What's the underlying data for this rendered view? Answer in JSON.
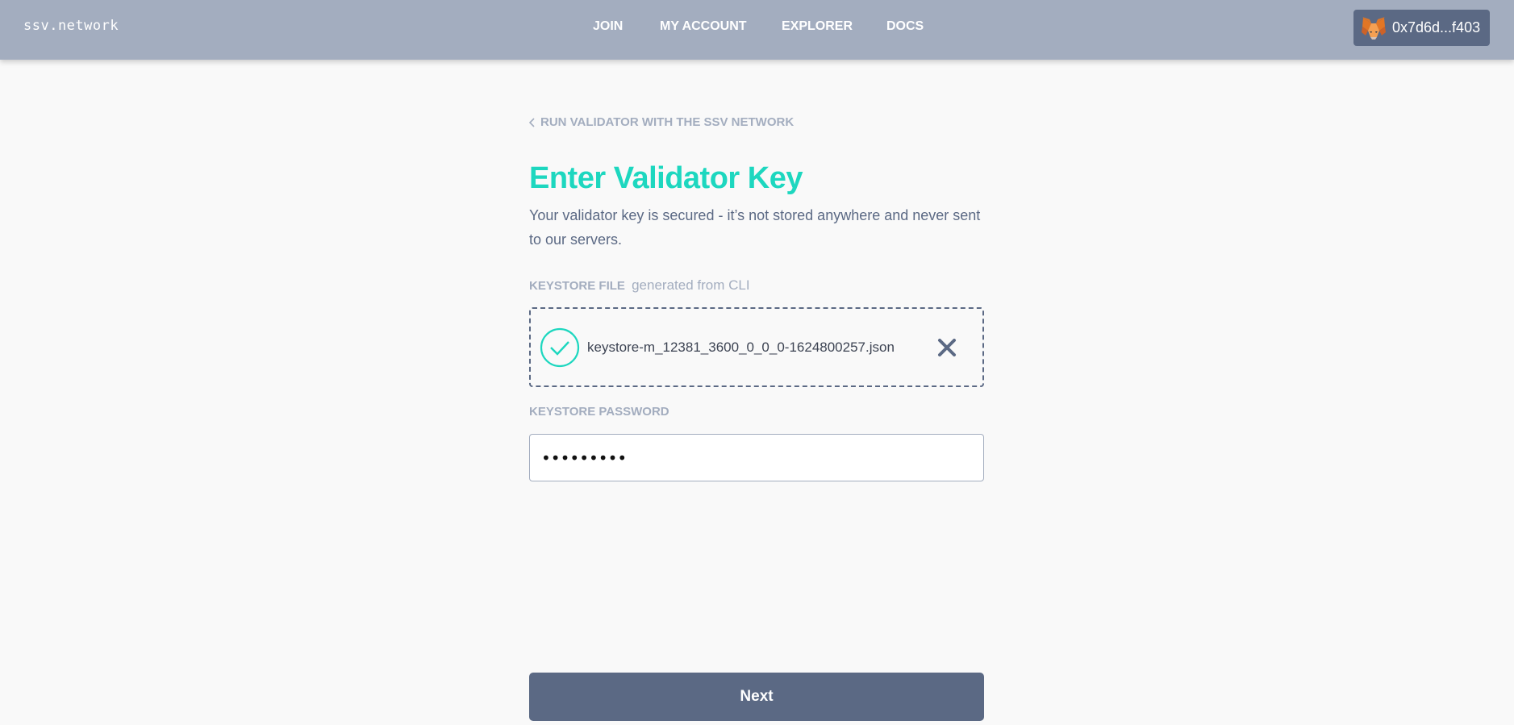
{
  "header": {
    "logo": "ssv.network",
    "nav": [
      {
        "label": "JOIN"
      },
      {
        "label": "MY ACCOUNT"
      },
      {
        "label": "EXPLORER"
      },
      {
        "label": "DOCS"
      }
    ],
    "wallet": {
      "address": "0x7d6d...f403",
      "icon": "metamask-fox-icon"
    }
  },
  "page": {
    "back_link": "RUN VALIDATOR WITH THE SSV NETWORK",
    "title": "Enter Validator Key",
    "subtitle": "Your validator key is secured - it’s not stored anywhere and never sent to our servers."
  },
  "keystore_file": {
    "label": "KEYSTORE FILE",
    "hint": "generated from CLI",
    "filename": "keystore-m_12381_3600_0_0_0-1624800257.json",
    "status_icon": "check-circle-icon",
    "remove_icon": "close-icon"
  },
  "keystore_password": {
    "label": "KEYSTORE PASSWORD",
    "value": "xxxxxxxxx"
  },
  "actions": {
    "next_label": "Next"
  },
  "colors": {
    "header_bg": "#a3adbf",
    "accent": "#1dd7bf",
    "primary_button": "#5b6984",
    "page_bg": "#f9f9f9"
  }
}
